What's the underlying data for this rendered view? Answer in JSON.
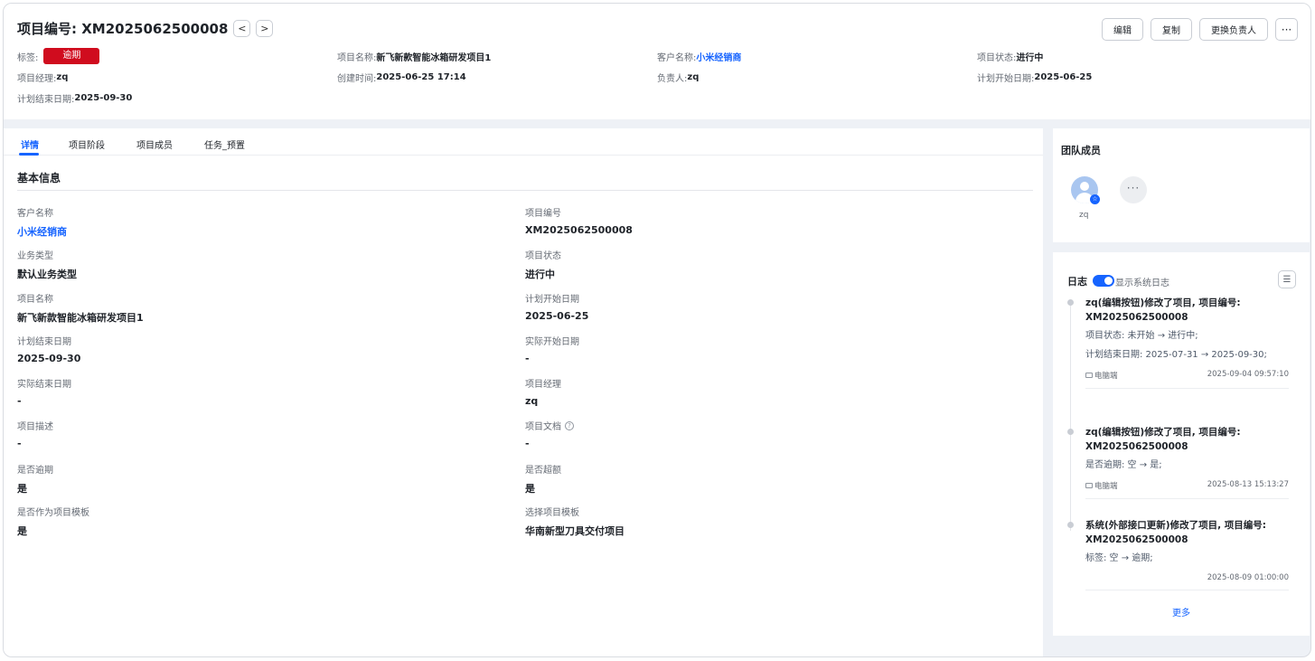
{
  "header": {
    "title": "项目编号: XM2025062500008",
    "prev_icon": "chevron-left-icon",
    "next_icon": "chevron-right-icon",
    "actions": {
      "edit": "编辑",
      "copy": "复制",
      "change_owner": "更换负责人",
      "more": "···"
    },
    "meta": {
      "tag_label": "标签:",
      "tag_value": "逾期",
      "project_name_label": "项目名称:",
      "project_name_value": "新飞新款智能冰箱研发项目1",
      "customer_label": "客户名称:",
      "customer_value": "小米经销商",
      "status_label": "项目状态:",
      "status_value": "进行中",
      "manager_label": "项目经理:",
      "manager_value": "zq",
      "created_label": "创建时间:",
      "created_value": "2025-06-25 17:14",
      "owner_label": "负责人:",
      "owner_value": "zq",
      "plan_start_label": "计划开始日期:",
      "plan_start_value": "2025-06-25",
      "plan_end_label": "计划结束日期:",
      "plan_end_value": "2025-09-30"
    }
  },
  "tabs": [
    "详情",
    "项目阶段",
    "项目成员",
    "任务_预置"
  ],
  "section_title": "基本信息",
  "fields": [
    {
      "label": "客户名称",
      "value": "小米经销商"
    },
    {
      "label": "项目编号",
      "value": "XM2025062500008"
    },
    {
      "label": "业务类型",
      "value": "默认业务类型"
    },
    {
      "label": "项目状态",
      "value": "进行中"
    },
    {
      "label": "项目名称",
      "value": "新飞新款智能冰箱研发项目1"
    },
    {
      "label": "计划开始日期",
      "value": "2025-06-25"
    },
    {
      "label": "计划结束日期",
      "value": "2025-09-30"
    },
    {
      "label": "实际开始日期",
      "value": "-"
    },
    {
      "label": "实际结束日期",
      "value": "-"
    },
    {
      "label": "项目经理",
      "value": "zq"
    },
    {
      "label": "项目描述",
      "value": "-"
    },
    {
      "label": "项目文档",
      "value": "-"
    },
    {
      "label": "是否逾期",
      "value": "是"
    },
    {
      "label": "是否超额",
      "value": "是"
    },
    {
      "label": "是否作为项目模板",
      "value": "是"
    },
    {
      "label": "选择项目模板",
      "value": "华南新型刀具交付项目"
    }
  ],
  "team": {
    "title": "团队成员",
    "member_name": "zq",
    "more": "···"
  },
  "log": {
    "title": "日志",
    "toggle_label": "显示系统日志",
    "entries": [
      {
        "title": "zq(编辑按钮)修改了项目, 项目编号: XM2025062500008",
        "lines": [
          "项目状态: 未开始 → 进行中;",
          "计划结束日期: 2025-07-31 → 2025-09-30;"
        ],
        "source": "电脑端",
        "time": "2025-09-04 09:57:10"
      },
      {
        "title": "zq(编辑按钮)修改了项目, 项目编号: XM2025062500008",
        "lines": [
          "是否逾期: 空 → 是;"
        ],
        "source": "电脑端",
        "time": "2025-08-13 15:13:27"
      },
      {
        "title": "系统(外部接口更新)修改了项目, 项目编号: XM2025062500008",
        "lines": [
          "标签: 空 → 逾期;"
        ],
        "source": "",
        "time": "2025-08-09 01:00:00"
      }
    ],
    "more": "更多"
  },
  "colors": {
    "accent": "#1664ff",
    "tag_red": "#d00c1e"
  }
}
